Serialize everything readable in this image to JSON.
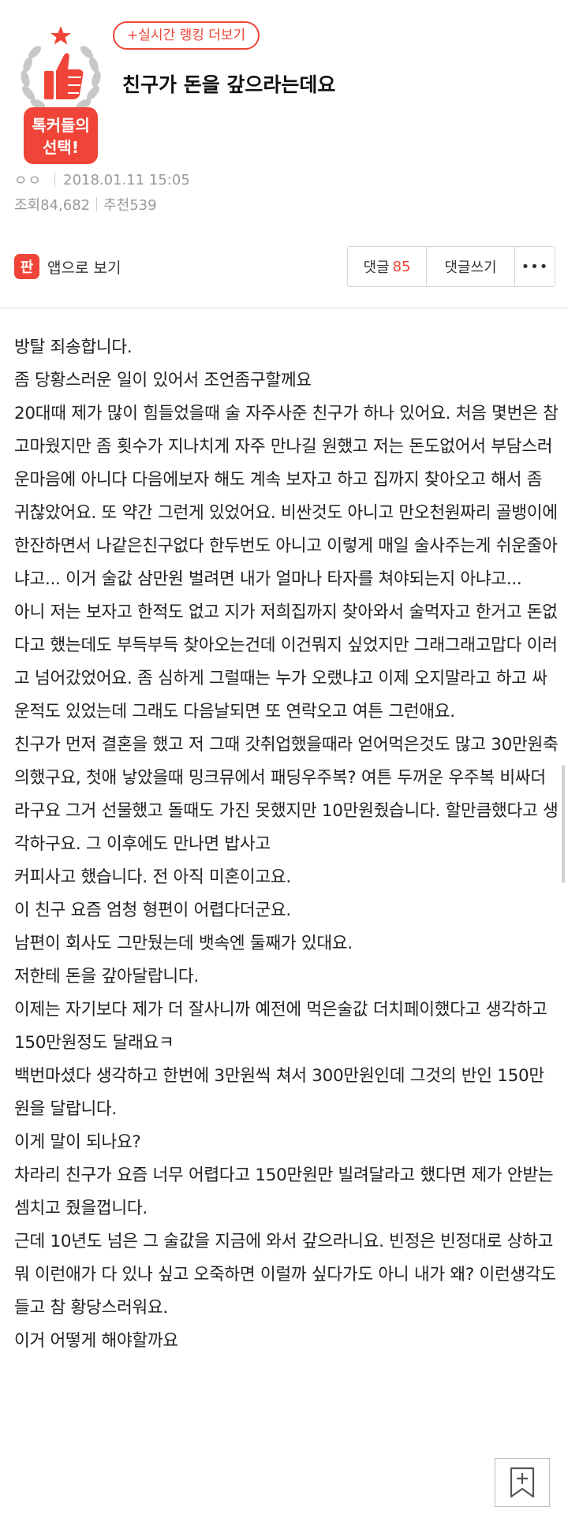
{
  "header": {
    "ranking_button": "+실시간 랭킹 더보기",
    "badge_line1": "톡커들의",
    "badge_line2": "선택!",
    "title": "친구가 돈을 갚으라는데요",
    "author": "ㅇㅇ",
    "datetime": "2018.01.11 15:05",
    "views": "조회84,682",
    "recommend": "추천539"
  },
  "actions": {
    "app_icon_label": "판",
    "app_view": "앱으로 보기",
    "reply_label": "댓글",
    "reply_count": "85",
    "write_reply": "댓글쓰기",
    "more": "•••"
  },
  "body": [
    "방탈 죄송합니다.",
    "좀 당황스러운 일이 있어서 조언좀구할께요",
    "20대때 제가 많이 힘들었을때 술 자주사준 친구가 하나 있어요. 처음 몇번은 참 고마웠지만 좀 횟수가 지나치게 자주 만나길 원했고 저는 돈도없어서 부담스러운마음에 아니다 다음에보자 해도 계속 보자고 하고 집까지 찾아오고 해서 좀 귀찮았어요. 또 약간 그런게 있었어요. 비싼것도 아니고 만오천원짜리 골뱅이에 한잔하면서 나같은친구없다 한두번도 아니고 이렇게 매일 술사주는게 쉬운줄아냐고... 이거 술값 삼만원 벌려면 내가 얼마나 타자를 쳐야되는지 아냐고...",
    "아니 저는 보자고 한적도 없고 지가 저희집까지 찾아와서 술먹자고 한거고 돈없다고 했는데도 부득부득 찾아오는건데 이건뭐지 싶었지만 그래그래고맙다 이러고 넘어갔었어요. 좀 심하게 그럴때는 누가 오랬냐고 이제 오지말라고 하고 싸운적도 있었는데 그래도 다음날되면 또 연락오고 여튼 그런애요.",
    "친구가 먼저 결혼을 했고 저 그때 갓취업했을때라 얻어먹은것도 많고 30만원축의했구요, 첫애 낳았을때 밍크뮤에서 패딩우주복? 여튼 두꺼운 우주복 비싸더라구요 그거 선물했고 돌때도 가진 못했지만 10만원줬습니다. 할만큼했다고 생각하구요. 그 이후에도 만나면 밥사고",
    "커피사고 했습니다. 전 아직 미혼이고요.",
    "이 친구 요즘 엄청 형편이 어렵다더군요.",
    "남편이 회사도 그만뒀는데 뱃속엔 둘째가 있대요.",
    "저한테 돈을 갚아달랍니다.",
    "이제는 자기보다 제가 더 잘사니까 예전에 먹은술값 더치페이했다고 생각하고 150만원정도 달래요ㅋ",
    "백번마셨다 생각하고 한번에 3만원씩 쳐서 300만원인데 그것의 반인 150만원을 달랍니다.",
    "이게 말이 되나요?",
    "차라리 친구가 요즘 너무 어렵다고 150만원만 빌려달라고 했다면 제가 안받는셈치고 줬을껍니다.",
    "근데 10년도 넘은 그 술값을 지금에 와서 갚으라니요. 빈정은 빈정대로 상하고 뭐 이런애가 다 있나 싶고 오죽하면 이럴까 싶다가도 아니 내가 왜? 이런생각도 들고 참 황당스러워요.",
    "이거 어떻게 해야할까요"
  ]
}
